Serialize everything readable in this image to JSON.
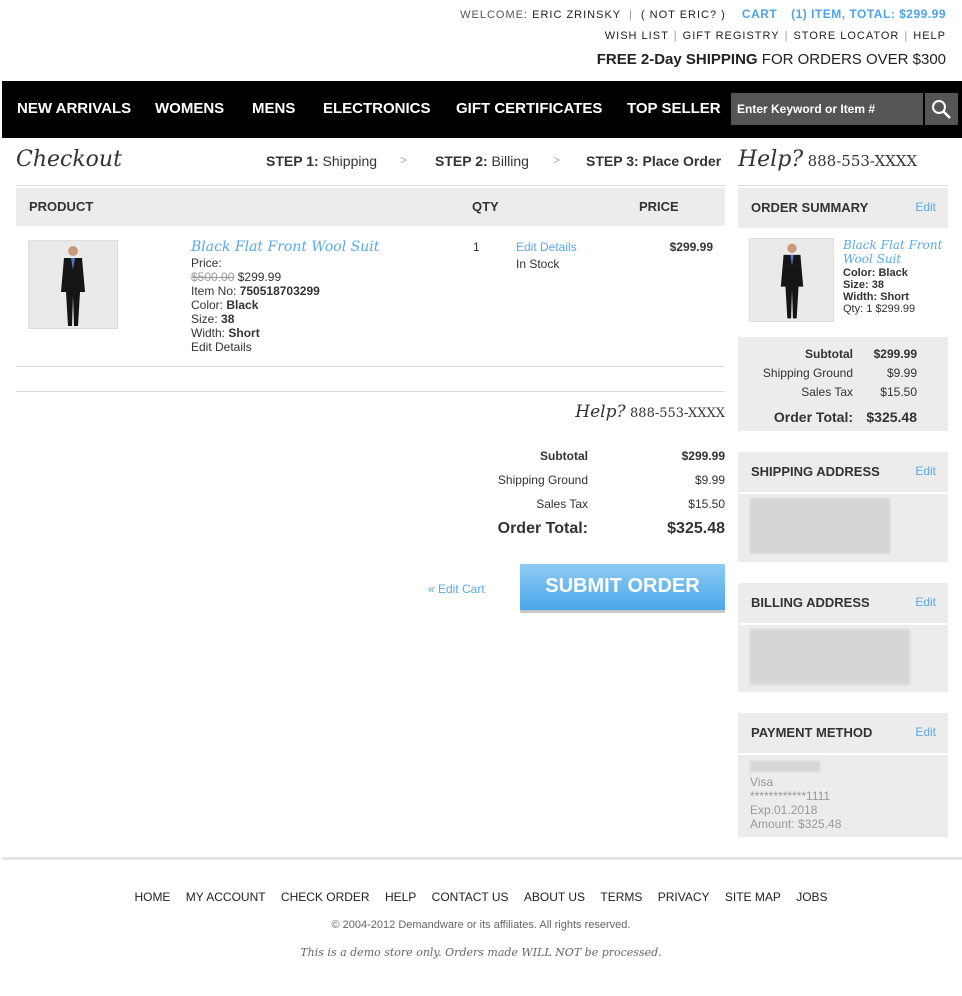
{
  "header": {
    "welcome_label": "WELCOME:",
    "user_name": "ERIC ZRINSKY",
    "not_user": "( NOT ERIC? )",
    "cart_label": "CART",
    "cart_summary": "(1) ITEM, TOTAL: $299.99",
    "links": [
      "WISH LIST",
      "GIFT REGISTRY",
      "STORE LOCATOR",
      "HELP"
    ],
    "promo_bold": "FREE 2-Day SHIPPING",
    "promo_rest": "FOR ORDERS OVER $300"
  },
  "nav": {
    "items": [
      "NEW ARRIVALS",
      "WOMENS",
      "MENS",
      "ELECTRONICS",
      "GIFT CERTIFICATES",
      "TOP SELLER"
    ],
    "search_placeholder": "Enter Keyword or Item #"
  },
  "checkout": {
    "title": "Checkout",
    "steps": [
      {
        "num": "STEP 1:",
        "label": "Shipping"
      },
      {
        "num": "STEP 2:",
        "label": "Billing"
      },
      {
        "num": "STEP 3:",
        "label": "Place Order"
      }
    ],
    "separator": ">",
    "help_label": "Help?",
    "help_phone": "888-553-XXXX"
  },
  "cart_table": {
    "headers": {
      "product": "PRODUCT",
      "qty": "QTY",
      "price": "PRICE"
    },
    "item": {
      "name": "Black Flat Front Wool Suit",
      "price_label": "Price:",
      "old_price": "$500.00",
      "sale_price": "$299.99",
      "item_no_label": "Item No:",
      "item_no": "750518703299",
      "color_label": "Color:",
      "color": "Black",
      "size_label": "Size:",
      "size": "38",
      "width_label": "Width:",
      "width": "Short",
      "edit_details": "Edit Details",
      "qty": "1",
      "stock": "In Stock",
      "price": "$299.99"
    }
  },
  "totals": {
    "subtotal_label": "Subtotal",
    "subtotal": "$299.99",
    "shipping_label": "Shipping Ground",
    "shipping": "$9.99",
    "tax_label": "Sales Tax",
    "tax": "$15.50",
    "total_label": "Order Total:",
    "total": "$325.48"
  },
  "actions": {
    "edit_cart": "« Edit Cart",
    "submit": "SUBMIT ORDER"
  },
  "sidebar": {
    "edit": "Edit",
    "order_summary": {
      "title": "ORDER SUMMARY",
      "name": "Black Flat Front Wool Suit",
      "color_label": "Color:",
      "color": "Black",
      "size_label": "Size:",
      "size": "38",
      "width_label": "Width:",
      "width": "Short",
      "qty_line": "Qty: 1 $299.99"
    },
    "shipping_address_title": "SHIPPING ADDRESS",
    "billing_address_title": "BILLING ADDRESS",
    "payment": {
      "title": "PAYMENT METHOD",
      "card_type": "Visa",
      "card_number": "************1111",
      "expiry": "Exp.01.2018",
      "amount": "Amount: $325.48"
    }
  },
  "footer": {
    "links": [
      "HOME",
      "MY ACCOUNT",
      "CHECK ORDER",
      "HELP",
      "CONTACT US",
      "ABOUT US",
      "TERMS",
      "PRIVACY",
      "SITE MAP",
      "JOBS"
    ],
    "copyright": "© 2004-2012 Demandware or its affiliates. All rights reserved.",
    "demo_notice": "This is a demo store only. Orders made WILL NOT be processed."
  },
  "colors": {
    "accent": "#5aa9e6",
    "nav_bg": "#000000",
    "panel_bg": "#ececec"
  }
}
